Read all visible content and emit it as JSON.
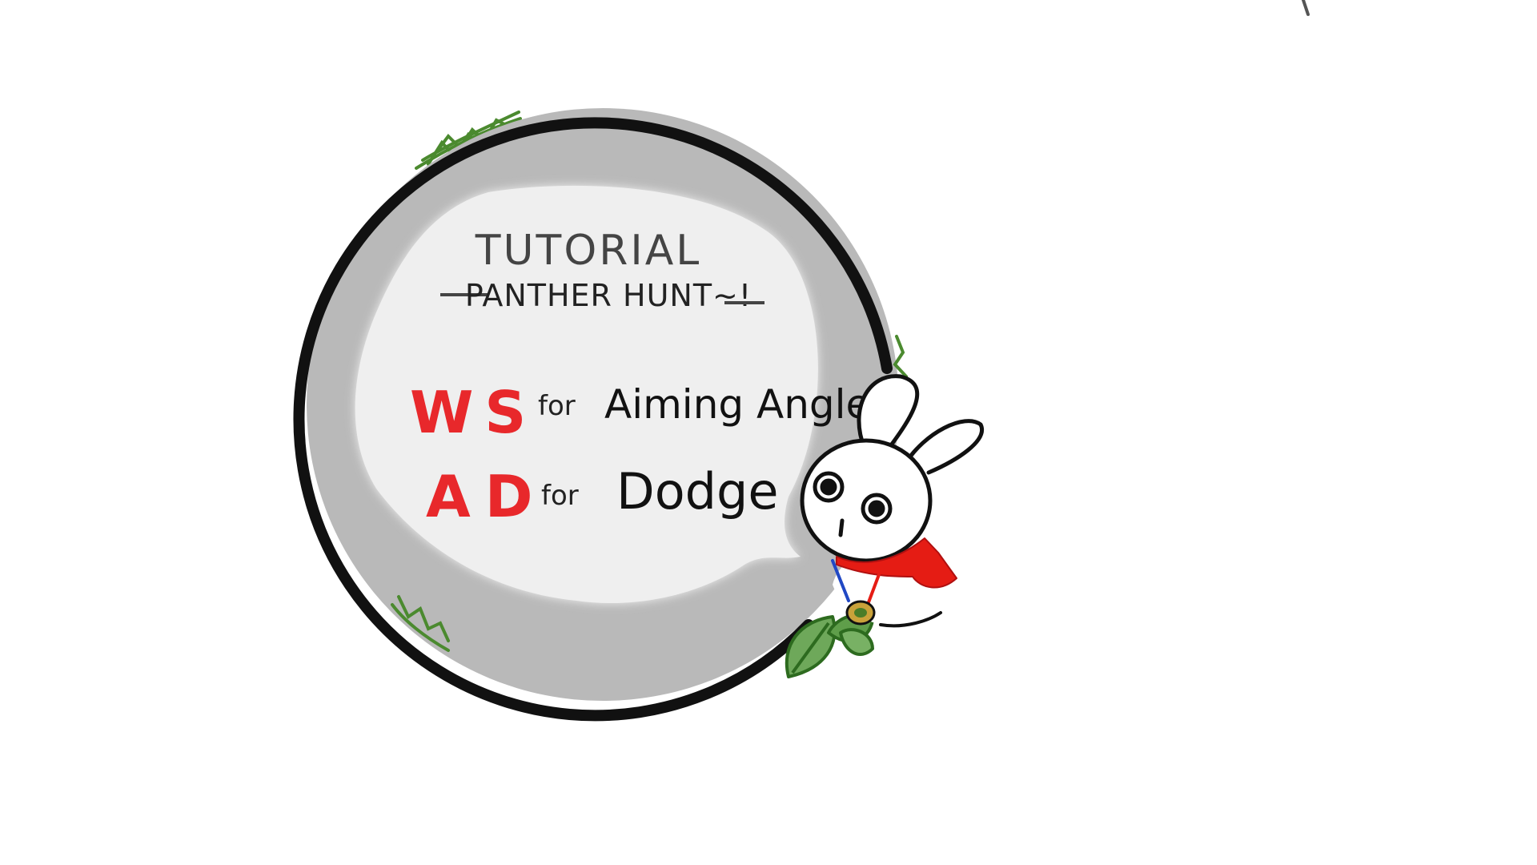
{
  "tutorial": {
    "title": "TUTORIAL",
    "subtitle": "PANTHER HUNT~!",
    "controls": [
      {
        "keys": "WS",
        "connector": "for",
        "action": "Aiming Angle"
      },
      {
        "keys": "AD",
        "connector": "for",
        "action": "Dodge"
      }
    ]
  },
  "colors": {
    "key_text": "#e8282b",
    "ink": "#111111",
    "ring_fill": "#b9b9b9",
    "bubble_fill": "#efefef",
    "leaf_green": "#3f8a2e",
    "scarf_red": "#e51c14"
  },
  "icons": {
    "mascot": "bunny-mascot-icon",
    "leaves": "leaf-icon",
    "medal": "medal-icon"
  }
}
